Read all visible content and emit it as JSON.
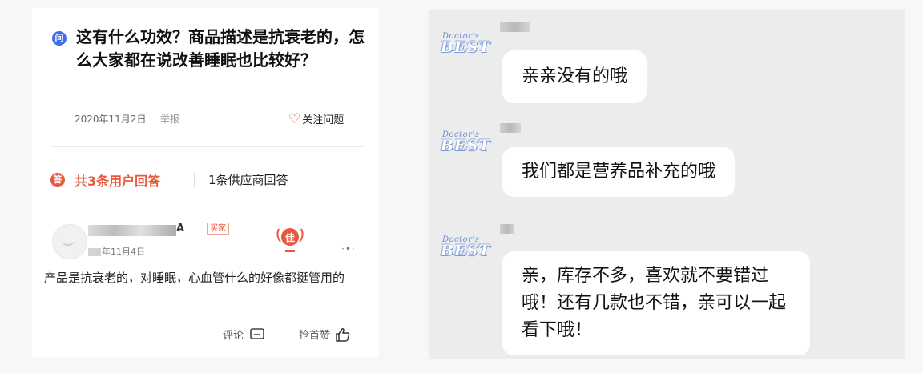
{
  "question": {
    "icon_char": "问",
    "title": "这有什么功效？商品描述是抗衰老的，怎么大家都在说改善睡眠也比较好？",
    "date": "2020年11月2日",
    "report": "举报",
    "follow_label": "关注问题"
  },
  "answers_tabs": {
    "icon_char": "答",
    "users_label": "共3条用户回答",
    "suppliers_label": "1条供应商回答"
  },
  "answer": {
    "user_suffix": "A",
    "buyer_tag": "买家",
    "date": "年11月4日",
    "badge_char": "佳",
    "text": "产品是抗衰老的，对睡眠，心血管什么的好像都挺管用的",
    "comment_label": "评论",
    "like_label": "抢首赞"
  },
  "chat": {
    "logo_script": "Doctor's",
    "logo_text": "BEST",
    "messages": [
      {
        "text": "亲亲没有的哦"
      },
      {
        "text": "我们都是营养品补充的哦"
      },
      {
        "text": "亲，库存不多，喜欢就不要错过哦！还有几款也不错，亲可以一起看下哦！"
      }
    ]
  },
  "colors": {
    "accent_red": "#e8583f",
    "question_blue": "#3f6ee8",
    "chat_bg": "#ececec"
  }
}
